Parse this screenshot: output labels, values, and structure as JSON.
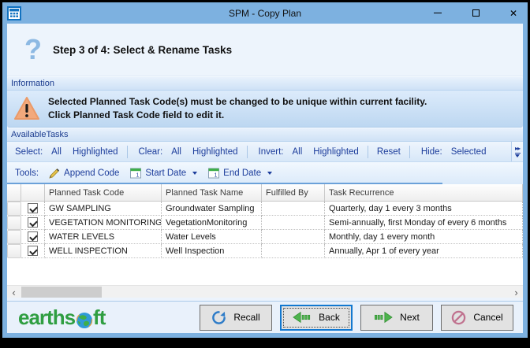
{
  "window": {
    "title": "SPM - Copy Plan",
    "close_glyph": "✕"
  },
  "header": {
    "help_glyph": "?",
    "step_title": "Step 3 of 4: Select & Rename Tasks"
  },
  "information": {
    "group_label": "Information",
    "line1": "Selected Planned Task Code(s) must be changed to be unique within current facility.",
    "line2": "Click Planned Task Code field to edit it."
  },
  "available_tasks": {
    "group_label": "AvailableTasks",
    "select_toolbar": {
      "select_label": "Select:",
      "select_all": "All",
      "select_highlighted": "Highlighted",
      "clear_label": "Clear:",
      "clear_all": "All",
      "clear_highlighted": "Highlighted",
      "invert_label": "Invert:",
      "invert_all": "All",
      "invert_highlighted": "Highlighted",
      "reset": "Reset",
      "hide_label": "Hide:",
      "hide_selected": "Selected",
      "overflow_glyph": "▸▸"
    },
    "tools_toolbar": {
      "tools_label": "Tools:",
      "append_code": "Append Code",
      "start_date": "Start Date",
      "end_date": "End Date"
    },
    "table": {
      "columns": [
        "Planned Task Code",
        "Planned Task Name",
        "Fulfilled By",
        "Task Recurrence"
      ],
      "rows": [
        {
          "checked": true,
          "code": "GW SAMPLING",
          "name": "Groundwater Sampling",
          "fulfilled_by": "",
          "recurrence": "Quarterly, day 1 every 3 months"
        },
        {
          "checked": true,
          "code": "VEGETATION MONITORING",
          "name": "VegetationMonitoring",
          "fulfilled_by": "",
          "recurrence": "Semi-annually, first Monday of every 6 months"
        },
        {
          "checked": true,
          "code": "WATER LEVELS",
          "name": "Water Levels",
          "fulfilled_by": "",
          "recurrence": "Monthly, day 1 every month"
        },
        {
          "checked": true,
          "code": "WELL INSPECTION",
          "name": "Well Inspection",
          "fulfilled_by": "",
          "recurrence": "Annually, Apr 1 of every year"
        }
      ]
    },
    "scrollbar": {
      "left_glyph": "‹",
      "right_glyph": "›"
    }
  },
  "footer": {
    "logo_left": "earths",
    "logo_right": "ft",
    "buttons": [
      {
        "label": "Recall"
      },
      {
        "label": "Back"
      },
      {
        "label": "Next"
      },
      {
        "label": "Cancel"
      }
    ]
  },
  "colors": {
    "titlebar_blue": "#7db1e0",
    "toolbar_text_blue": "#1b3c9b",
    "brand_green": "#2f9e41",
    "warning_orange": "#f0a478",
    "focus_blue": "#1278d0"
  }
}
